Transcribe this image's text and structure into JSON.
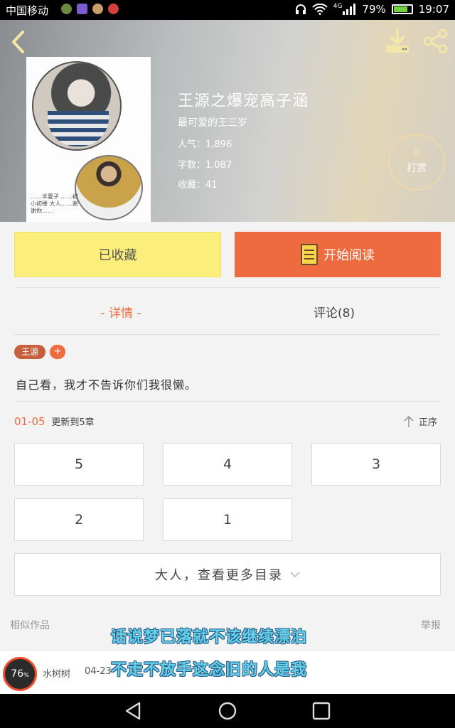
{
  "status_bar": {
    "carrier": "中国移动",
    "network": "4G",
    "battery_percent": "79%",
    "battery_level": 0.79,
    "time": "19:07"
  },
  "book": {
    "title": "王源之爆宠高子涵",
    "author": "最可爱的王三岁",
    "popularity": "人气：1,896",
    "word_count": "字数：1,087",
    "collections": "收藏：41",
    "cover_note": "……半夏子 ……初小初楼 大人……谢谢你……",
    "tip_count": "0",
    "tip_label": "打赏"
  },
  "actions": {
    "favorite_label": "已收藏",
    "read_label": "开始阅读"
  },
  "tabs": {
    "detail": "- 详情 -",
    "comments": "评论(8)"
  },
  "tags": [
    "王源"
  ],
  "tag_add": "+",
  "intro": "自己看，我才不告诉你们我很懒。",
  "update": {
    "range": "01-05",
    "text": "更新到5章",
    "order_label": "正序"
  },
  "chapters": [
    "5",
    "4",
    "3",
    "2",
    "1"
  ],
  "more_label": "大人，查看更多目录",
  "similar_label": "相似作品",
  "report_label": "举报",
  "overlay_lyrics": [
    "话说梦已落就不该继续漂泊",
    "不走不放手这念旧的人是我"
  ],
  "footer": {
    "dial_value": "76",
    "dial_unit": "%",
    "user": "水树树",
    "date": "04-23"
  },
  "colors": {
    "accent": "#ef6b3d",
    "favorite_bg": "#fbee7b",
    "lyric": "#63d2e9"
  }
}
